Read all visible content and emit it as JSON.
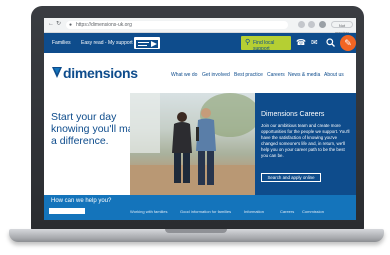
{
  "browser": {
    "url": "https://dimensions-uk.org",
    "sync_label": "Not syncing"
  },
  "site": {
    "topbar": {
      "links": [
        "Families",
        "Easy read - My support"
      ],
      "find_support_label": "Find local support"
    },
    "logo_text": "dimensions",
    "nav": [
      "What we do",
      "Get involved",
      "Best practice",
      "Careers",
      "News & media",
      "About us"
    ],
    "hero": {
      "heading": "Start your day knowing you'll make a difference."
    },
    "careers": {
      "title": "Dimensions Careers",
      "body": "Join our ambitious team and create more opportunities for the people we support. You'll have the satisfaction of knowing you've changed someone's life and, in return, we'll help you on your career path to be the best you can be.",
      "button_label": "Search and apply online"
    },
    "help": {
      "title": "How can we help you?",
      "tabs": [
        "",
        "Working with families",
        "Good information for families",
        "Information",
        "Careers",
        "Commission"
      ]
    }
  },
  "colors": {
    "brand_navy": "#0e4c8c",
    "brand_blue": "#1474bb",
    "accent_green": "#b5cf33",
    "accent_orange": "#f26522"
  }
}
